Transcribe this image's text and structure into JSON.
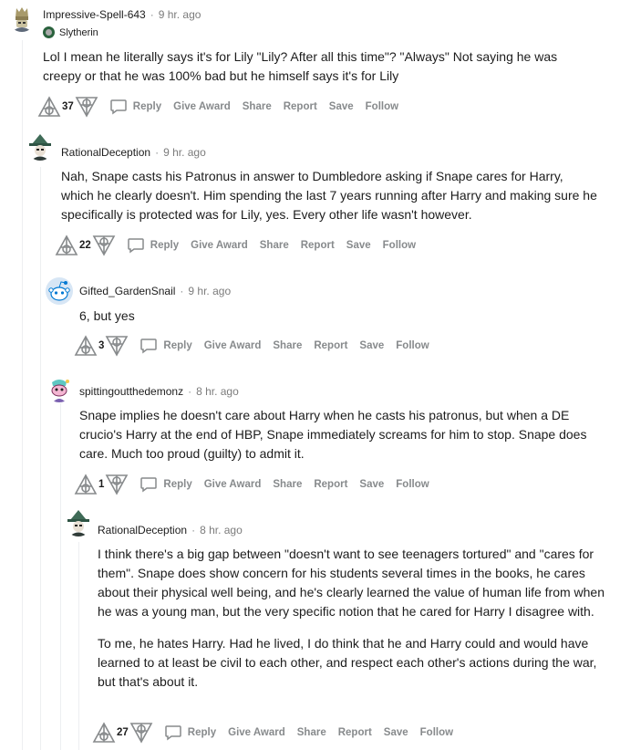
{
  "comments": [
    {
      "username": "Impressive-Spell-643",
      "time": "9 hr. ago",
      "flair": "Slytherin",
      "avatar": "wizard-helmet-avatar",
      "paragraphs": [
        "Lol I mean he literally says it's for Lily \"Lily? After all this time\"? \"Always\" Not saying he was creepy or that he was 100% bad but he himself says it's for Lily"
      ],
      "score": "37"
    },
    {
      "username": "RationalDeception",
      "time": "9 hr. ago",
      "avatar": "green-witch-hat-avatar",
      "paragraphs": [
        "Nah, Snape casts his Patronus in answer to Dumbledore asking if Snape cares for Harry, which he clearly doesn't. Him spending the last 7 years running after Harry and making sure he specifically is protected was for Lily, yes. Every other life wasn't however."
      ],
      "score": "22"
    },
    {
      "username": "Gifted_GardenSnail",
      "time": "9 hr. ago",
      "avatar": "snoo-default-avatar",
      "paragraphs": [
        "6, but yes"
      ],
      "score": "3"
    },
    {
      "username": "spittingoutthedemonz",
      "time": "8 hr. ago",
      "avatar": "pink-snoo-avatar",
      "paragraphs": [
        "Snape implies he doesn't care about Harry when he casts his patronus, but when a DE crucio's Harry at the end of HBP, Snape immediately screams for him to stop. Snape does care. Much too proud (guilty) to admit it."
      ],
      "score": "1"
    },
    {
      "username": "RationalDeception",
      "time": "8 hr. ago",
      "avatar": "green-witch-hat-avatar",
      "paragraphs": [
        "I think there's a big gap between \"doesn't want to see teenagers tortured\" and \"cares for them\". Snape does show concern for his students several times in the books, he cares about their physical well being, and he's clearly learned the value of human life from when he was a young man, but the very specific notion that he cared for Harry I disagree with.",
        "To me, he hates Harry. Had he lived, I do think that he and Harry could and would have learned to at least be civil to each other, and respect each other's actions during the war, but that's about it."
      ],
      "score": "27"
    }
  ],
  "actions": {
    "reply": "Reply",
    "give_award": "Give Award",
    "share": "Share",
    "report": "Report",
    "save": "Save",
    "follow": "Follow"
  },
  "separator": "·",
  "colors": {
    "text": "#1c1c1c",
    "meta": "#878a8c",
    "thread_line": "#edeff1",
    "flair_green": "#2a623d"
  }
}
